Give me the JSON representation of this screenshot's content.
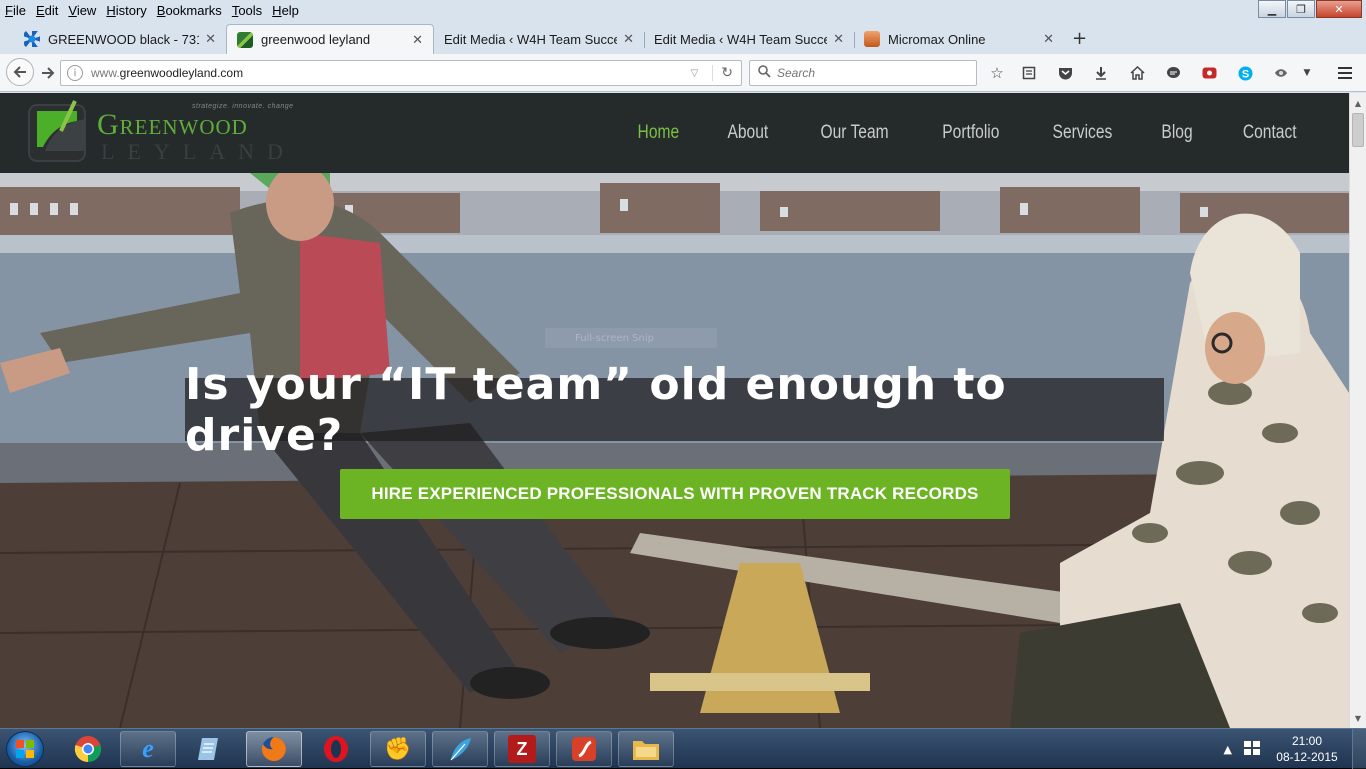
{
  "menu": [
    "File",
    "Edit",
    "View",
    "History",
    "Bookmarks",
    "Tools",
    "Help"
  ],
  "tabs": [
    {
      "title": "GREENWOOD black - 7311...",
      "icon": "blue-burst-icon",
      "active": false
    },
    {
      "title": "greenwood leyland",
      "icon": "greenwood-favicon",
      "active": true
    },
    {
      "title": "Edit Media ‹ W4H Team Succes...",
      "icon": "",
      "active": false
    },
    {
      "title": "Edit Media ‹ W4H Team Succes...",
      "icon": "",
      "active": false
    },
    {
      "title": "Micromax Online",
      "icon": "micromax-favicon",
      "active": false
    }
  ],
  "addressbar": {
    "prefix": "www.",
    "domain": "greenwoodleyland.com"
  },
  "search": {
    "placeholder": "Search"
  },
  "site": {
    "logo": {
      "name": "Greenwood",
      "sub": "LEYLAND",
      "tagline": "strategize. innovate. change"
    },
    "nav": [
      "Home",
      "About",
      "Our Team",
      "Portfolio",
      "Services",
      "Blog",
      "Contact"
    ],
    "nav_active": "Home",
    "hero_title": "Is your “IT team” old enough to drive?",
    "cta_label": "HIRE EXPERIENCED PROFESSIONALS WITH PROVEN TRACK RECORDS",
    "snip_hint": "Full-screen Snip"
  },
  "taskbar": {
    "apps": [
      "chrome",
      "internet-explorer",
      "notepad",
      "firefox",
      "opera",
      "media-player",
      "feather-app",
      "filezilla",
      "flash",
      "file-explorer"
    ],
    "time": "21:00",
    "date": "08-12-2015"
  },
  "colors": {
    "accent_green": "#7bc043",
    "cta_green": "#6db425",
    "header_bg": "#252a2b"
  }
}
